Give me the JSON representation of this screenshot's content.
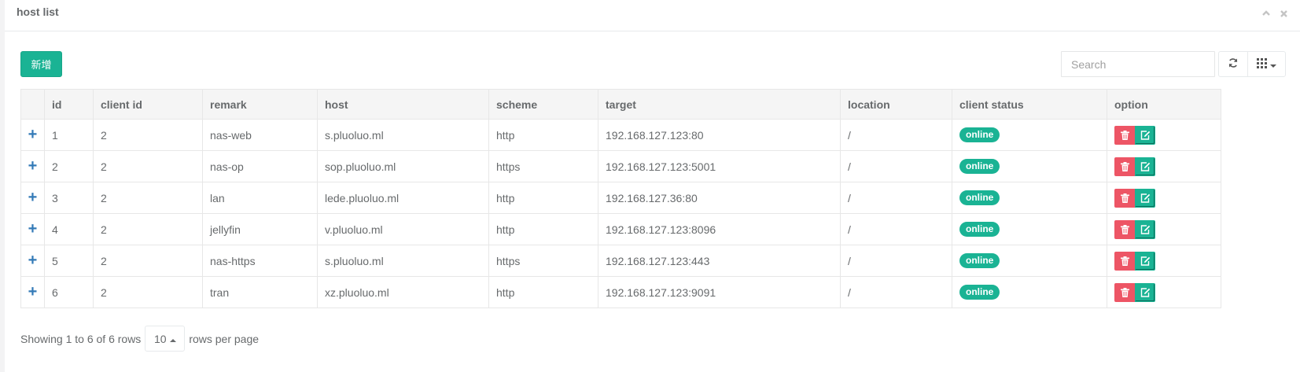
{
  "panel": {
    "title": "host list"
  },
  "toolbar": {
    "add_label": "新增",
    "search_placeholder": "Search"
  },
  "table": {
    "headers": [
      "id",
      "client id",
      "remark",
      "host",
      "scheme",
      "target",
      "location",
      "client status",
      "option"
    ],
    "rows": [
      {
        "id": "1",
        "client_id": "2",
        "remark": "nas-web",
        "host": "s.pluoluo.ml",
        "scheme": "http",
        "target": "192.168.127.123:80",
        "location": "/",
        "status": "online"
      },
      {
        "id": "2",
        "client_id": "2",
        "remark": "nas-op",
        "host": "sop.pluoluo.ml",
        "scheme": "https",
        "target": "192.168.127.123:5001",
        "location": "/",
        "status": "online"
      },
      {
        "id": "3",
        "client_id": "2",
        "remark": "lan",
        "host": "lede.pluoluo.ml",
        "scheme": "http",
        "target": "192.168.127.36:80",
        "location": "/",
        "status": "online"
      },
      {
        "id": "4",
        "client_id": "2",
        "remark": "jellyfin",
        "host": "v.pluoluo.ml",
        "scheme": "http",
        "target": "192.168.127.123:8096",
        "location": "/",
        "status": "online"
      },
      {
        "id": "5",
        "client_id": "2",
        "remark": "nas-https",
        "host": "s.pluoluo.ml",
        "scheme": "https",
        "target": "192.168.127.123:443",
        "location": "/",
        "status": "online"
      },
      {
        "id": "6",
        "client_id": "2",
        "remark": "tran",
        "host": "xz.pluoluo.ml",
        "scheme": "http",
        "target": "192.168.127.123:9091",
        "location": "/",
        "status": "online"
      }
    ]
  },
  "pagination": {
    "showing": "Showing 1 to 6 of 6 rows",
    "page_size": "10",
    "rows_per_page": "rows per page"
  },
  "colors": {
    "primary": "#1ab394",
    "danger": "#ed5565",
    "link": "#337ab7"
  },
  "icons": [
    "chevron-up-icon",
    "close-icon",
    "refresh-icon",
    "grid-icon",
    "caret-down-icon",
    "plus-icon",
    "trash-icon",
    "edit-icon",
    "caret-up-icon"
  ]
}
